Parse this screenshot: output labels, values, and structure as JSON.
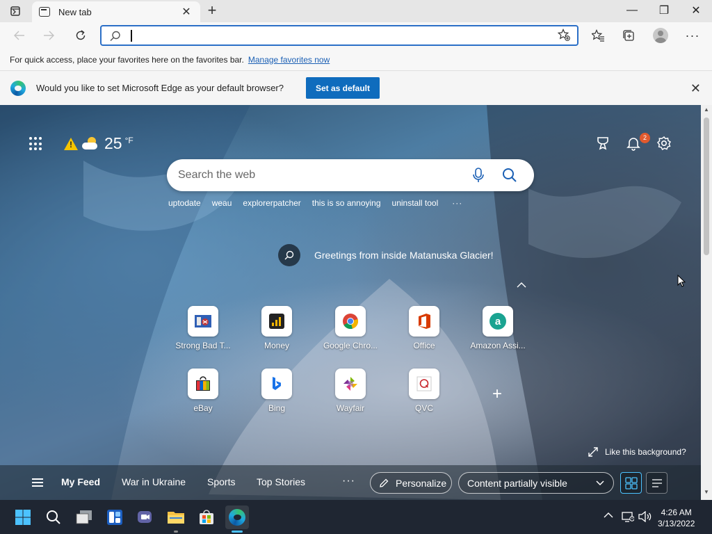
{
  "window": {
    "tab_title": "New tab",
    "new_tab_label": "+",
    "minimize": "—",
    "maximize": "❐",
    "close": "✕"
  },
  "toolbar": {
    "address_value": "",
    "icons": [
      "back-icon",
      "forward-icon",
      "refresh-icon",
      "search-icon",
      "add-favorite-icon",
      "favorites-icon",
      "collections-icon",
      "profile-avatar",
      "more-icon"
    ]
  },
  "favorites_bar": {
    "text": "For quick access, place your favorites here on the favorites bar.",
    "link": "Manage favorites now"
  },
  "infobar": {
    "message": "Would you like to set Microsoft Edge as your default browser?",
    "button": "Set as default"
  },
  "newtab": {
    "weather": {
      "temperature": "25",
      "unit": "°F"
    },
    "notification_count": "2",
    "search_placeholder": "Search the web",
    "trending": [
      "uptodate",
      "weau",
      "explorerpatcher",
      "this is so annoying",
      "uninstall tool"
    ],
    "trending_more": "···",
    "greeting": "Greetings from inside Matanuska Glacier!",
    "tiles": [
      {
        "label": "Strong Bad T...",
        "icon": "strong-bad-icon"
      },
      {
        "label": "Money",
        "icon": "money-icon"
      },
      {
        "label": "Google Chro...",
        "icon": "chrome-icon"
      },
      {
        "label": "Office",
        "icon": "office-icon"
      },
      {
        "label": "Amazon Assi...",
        "icon": "amazon-assistant-icon"
      },
      {
        "label": "eBay",
        "icon": "ebay-icon"
      },
      {
        "label": "Bing",
        "icon": "bing-icon"
      },
      {
        "label": "Wayfair",
        "icon": "wayfair-icon"
      },
      {
        "label": "QVC",
        "icon": "qvc-icon"
      }
    ],
    "like_background": "Like this background?",
    "feed": {
      "tabs": [
        "My Feed",
        "War in Ukraine",
        "Sports",
        "Top Stories"
      ],
      "more": "···",
      "personalize": "Personalize",
      "content_visibility": "Content partially visible"
    }
  },
  "taskbar": {
    "time": "4:26 AM",
    "date": "3/13/2022"
  },
  "colors": {
    "accent": "#0f6cbd",
    "address_border": "#2b6fc7",
    "taskbar": "#1f2632",
    "badge": "#e25a2e"
  }
}
